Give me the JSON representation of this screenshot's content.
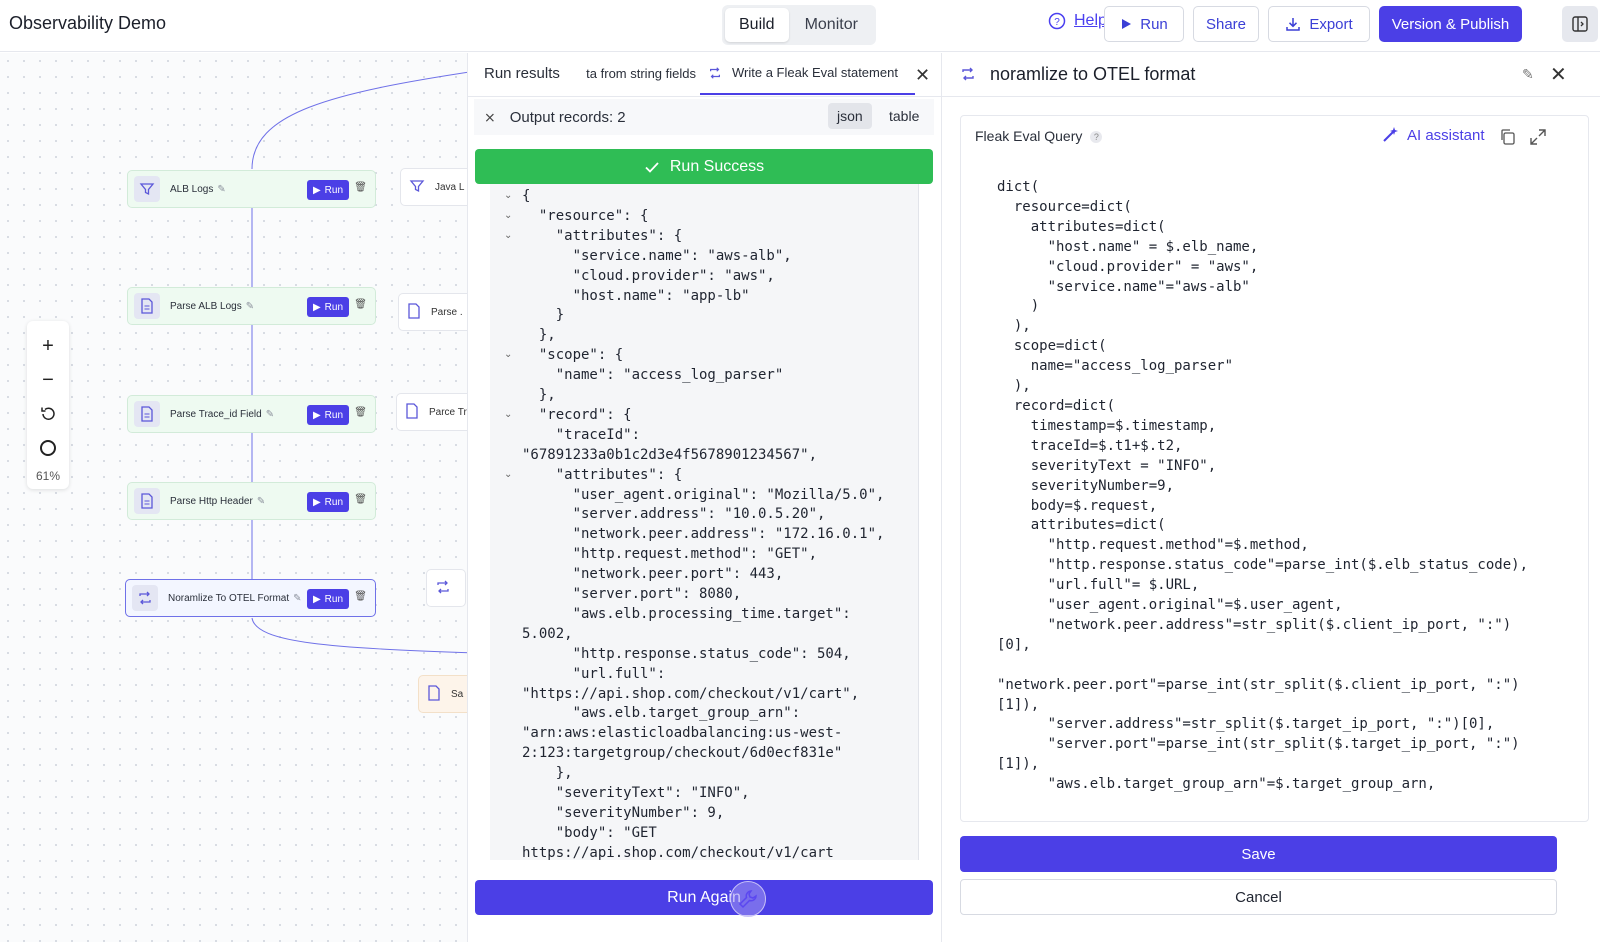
{
  "app": {
    "title": "Observability Demo"
  },
  "mode_toggle": {
    "build": "Build",
    "monitor": "Monitor"
  },
  "toolbar": {
    "help": "Help",
    "run": "Run",
    "share": "Share",
    "export": "Export",
    "publish": "Version & Publish"
  },
  "zoom": {
    "level": "61%"
  },
  "nodes": [
    {
      "label": "ALB Logs",
      "run": "Run"
    },
    {
      "label": "Parse ALB Logs",
      "run": "Run"
    },
    {
      "label": "Parse Trace_id Field",
      "run": "Run"
    },
    {
      "label": "Parse Http Header",
      "run": "Run"
    },
    {
      "label": "Noramlize To OTEL Format",
      "run": "Run"
    }
  ],
  "ghost_nodes": [
    "Java L",
    "Parse .",
    "Parce Tr",
    "",
    "Sa"
  ],
  "results": {
    "tabs": [
      "Run results",
      "ta from string fields",
      "Write a Fleak Eval statement"
    ],
    "output_label": "Output records: 2",
    "view_json": "json",
    "view_table": "table",
    "success": "Run Success",
    "run_again": "Run Again",
    "json_lines": [
      "{",
      "  \"resource\": {",
      "    \"attributes\": {",
      "      \"service.name\": \"aws-alb\",",
      "      \"cloud.provider\": \"aws\",",
      "      \"host.name\": \"app-lb\"",
      "    }",
      "  },",
      "  \"scope\": {",
      "    \"name\": \"access_log_parser\"",
      "  },",
      "  \"record\": {",
      "    \"traceId\":",
      "\"67891233a0b1c2d3e4f5678901234567\",",
      "    \"attributes\": {",
      "      \"user_agent.original\": \"Mozilla/5.0\",",
      "      \"server.address\": \"10.0.5.20\",",
      "      \"network.peer.address\": \"172.16.0.1\",",
      "      \"http.request.method\": \"GET\",",
      "      \"network.peer.port\": 443,",
      "      \"server.port\": 8080,",
      "      \"aws.elb.processing_time.target\":",
      "5.002,",
      "      \"http.response.status_code\": 504,",
      "      \"url.full\":",
      "\"https://api.shop.com/checkout/v1/cart\",",
      "      \"aws.elb.target_group_arn\":",
      "\"arn:aws:elasticloadbalancing:us-west-",
      "2:123:targetgroup/checkout/6d0ecf831e\"",
      "    },",
      "    \"severityText\": \"INFO\",",
      "    \"severityNumber\": 9,",
      "    \"body\": \"GET",
      "https://api.shop.com/checkout/v1/cart"
    ]
  },
  "editor": {
    "title": "noramlize to OTEL format",
    "query_label": "Fleak Eval Query",
    "ai_assistant": "AI assistant",
    "save": "Save",
    "cancel": "Cancel",
    "code": "dict(\n  resource=dict(\n    attributes=dict(\n      \"host.name\" = $.elb_name,\n      \"cloud.provider\" = \"aws\",\n      \"service.name\"=\"aws-alb\"\n    )\n  ),\n  scope=dict(\n    name=\"access_log_parser\"\n  ),\n  record=dict(\n    timestamp=$.timestamp,\n    traceId=$.t1+$.t2,\n    severityText = \"INFO\",\n    severityNumber=9,\n    body=$.request,\n    attributes=dict(\n      \"http.request.method\"=$.method,\n      \"http.response.status_code\"=parse_int($.elb_status_code),\n      \"url.full\"= $.URL,\n      \"user_agent.original\"=$.user_agent,\n      \"network.peer.address\"=str_split($.client_ip_port, \":\")\n[0],\n\n\"network.peer.port\"=parse_int(str_split($.client_ip_port, \":\")\n[1]),\n      \"server.address\"=str_split($.target_ip_port, \":\")[0],\n      \"server.port\"=parse_int(str_split($.target_ip_port, \":\")\n[1]),\n      \"aws.elb.target_group_arn\"=$.target_group_arn,"
  }
}
